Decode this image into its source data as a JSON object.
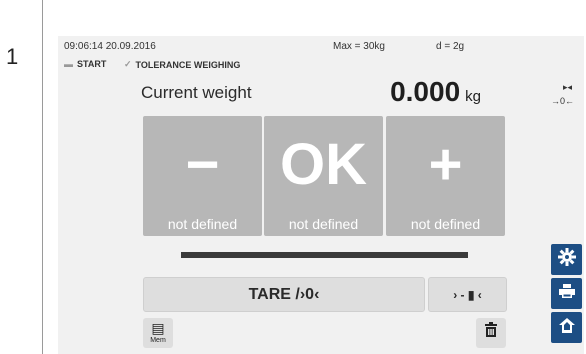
{
  "doc": {
    "step_number": "1"
  },
  "status": {
    "datetime": "09:06:14 20.09.2016",
    "max": "Max = 30kg",
    "division": "d = 2g"
  },
  "breadcrumb": {
    "start": "START",
    "application": "TOLERANCE WEIGHING"
  },
  "weight": {
    "label": "Current weight",
    "value": "0.000",
    "unit": "kg"
  },
  "indicators": {
    "tilt": "▸◂",
    "zero": "→0←"
  },
  "tolerance_buttons": [
    {
      "symbol": "−",
      "label": "not defined"
    },
    {
      "symbol": "OK",
      "label": "not defined"
    },
    {
      "symbol": "+",
      "label": "not defined"
    }
  ],
  "actions": {
    "tare": "TARE /›0‹",
    "level": "› - ▮ ‹"
  },
  "memory": {
    "label": "Mem"
  },
  "icons": {
    "memory": "memory-icon",
    "delete": "trash-icon",
    "settings": "gear-icon",
    "print": "printer-icon",
    "home": "home-icon"
  },
  "colors": {
    "side_button": "#1d4e84",
    "tolerance_button": "#b7b7b7",
    "progress_bar": "#3a3a3a"
  }
}
